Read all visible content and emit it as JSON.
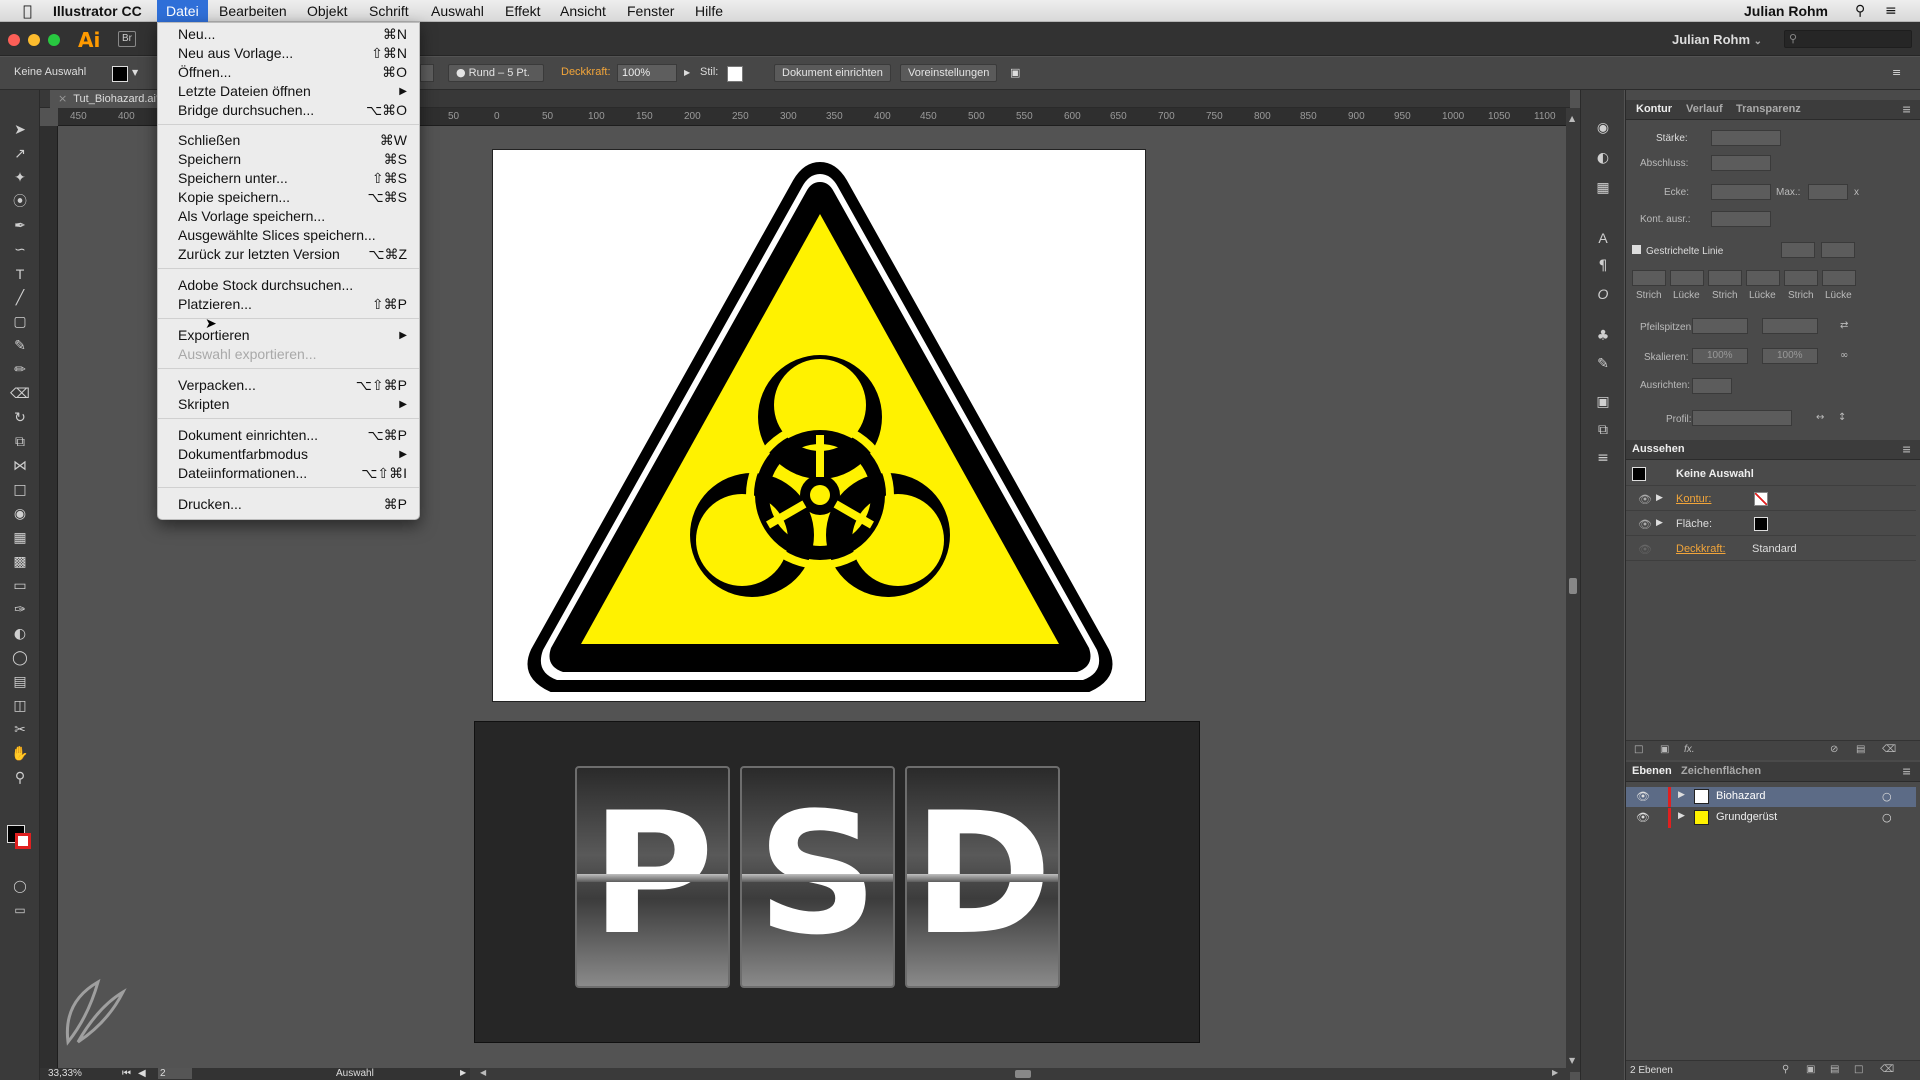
{
  "menubar": {
    "apple": "",
    "app_name": "Illustrator CC",
    "items": [
      "Datei",
      "Bearbeiten",
      "Objekt",
      "Schrift",
      "Auswahl",
      "Effekt",
      "Ansicht",
      "Fenster",
      "Hilfe"
    ],
    "user": "Julian Rohm"
  },
  "appbar": {
    "logo": "Ai",
    "bridge": "Br",
    "user": "Julian Rohm",
    "user_caret": "⌄"
  },
  "controlbar": {
    "selection": "Keine Auswahl",
    "brush": "Rund – 5 Pt.",
    "opacity_label": "Deckkraft:",
    "opacity_value": "100%",
    "style_label": "Stil:",
    "document_setup_button": "Dokument einrichten",
    "preferences_button": "Voreinstellungen"
  },
  "document": {
    "tab_title": "Tut_Biohazard.ai*",
    "ruler_ticks": [
      "450",
      "400",
      "50",
      "0",
      "50",
      "100",
      "150",
      "200",
      "250",
      "300",
      "350",
      "400",
      "450",
      "500",
      "550",
      "600",
      "650",
      "700",
      "750",
      "800",
      "850",
      "900",
      "950",
      "1000",
      "1050",
      "1100"
    ]
  },
  "artwork": {
    "letters": [
      "P",
      "S",
      "D"
    ],
    "colors": {
      "warning_yellow": "#fff200",
      "black": "#000000"
    }
  },
  "status": {
    "zoom": "33,33%",
    "page": "2",
    "tool_name": "Auswahl"
  },
  "file_menu": {
    "groups": [
      [
        {
          "label": "Neu...",
          "shortcut": "⌘N"
        },
        {
          "label": "Neu aus Vorlage...",
          "shortcut": "⇧⌘N"
        },
        {
          "label": "Öffnen...",
          "shortcut": "⌘O"
        },
        {
          "label": "Letzte Dateien öffnen",
          "shortcut": "▶"
        },
        {
          "label": "Bridge durchsuchen...",
          "shortcut": "⌥⌘O"
        }
      ],
      [
        {
          "label": "Schließen",
          "shortcut": "⌘W"
        },
        {
          "label": "Speichern",
          "shortcut": "⌘S"
        },
        {
          "label": "Speichern unter...",
          "shortcut": "⇧⌘S"
        },
        {
          "label": "Kopie speichern...",
          "shortcut": "⌥⌘S"
        },
        {
          "label": "Als Vorlage speichern...",
          "shortcut": ""
        },
        {
          "label": "Ausgewählte Slices speichern...",
          "shortcut": ""
        },
        {
          "label": "Zurück zur letzten Version",
          "shortcut": "⌥⌘Z"
        }
      ],
      [
        {
          "label": "Adobe Stock durchsuchen...",
          "shortcut": ""
        },
        {
          "label": "Platzieren...",
          "shortcut": "⇧⌘P"
        }
      ],
      [
        {
          "label": "Exportieren",
          "shortcut": "▶"
        },
        {
          "label": "Auswahl exportieren...",
          "shortcut": ""
        }
      ],
      [
        {
          "label": "Verpacken...",
          "shortcut": "⌥⇧⌘P"
        },
        {
          "label": "Skripten",
          "shortcut": "▶"
        }
      ],
      [
        {
          "label": "Dokument einrichten...",
          "shortcut": "⌥⌘P"
        },
        {
          "label": "Dokumentfarbmodus",
          "shortcut": "▶"
        },
        {
          "label": "Dateiinformationen...",
          "shortcut": "⌥⇧⌘I"
        }
      ],
      [
        {
          "label": "Drucken...",
          "shortcut": "⌘P"
        }
      ]
    ]
  },
  "stroke_panel": {
    "tabs": [
      "Kontur",
      "Verlauf",
      "Transparenz"
    ],
    "weight_label": "Stärke:",
    "cap_label": "Abschluss:",
    "corner_label": "Ecke:",
    "max_label": "Max.:",
    "max_unit": "x",
    "align_label": "Kont. ausr.:",
    "dashed_label": "Gestrichelte Linie",
    "dash_labels": [
      "Strich",
      "Lücke",
      "Strich",
      "Lücke",
      "Strich",
      "Lücke"
    ],
    "arrow_label": "Pfeilspitzen:",
    "scale_label": "Skalieren:",
    "scale_values": [
      "100%",
      "100%"
    ],
    "align_arrow_label": "Ausrichten:",
    "profile_label": "Profil:"
  },
  "appearance_panel": {
    "title": "Aussehen",
    "selection": "Keine Auswahl",
    "rows": [
      {
        "label": "Kontur:"
      },
      {
        "label": "Fläche:"
      },
      {
        "label": "Deckkraft:",
        "value": "Standard"
      }
    ]
  },
  "layers_panel": {
    "tabs": [
      "Ebenen",
      "Zeichenflächen"
    ],
    "layers": [
      "Biohazard",
      "Grundgerüst"
    ],
    "count": "2 Ebenen"
  }
}
